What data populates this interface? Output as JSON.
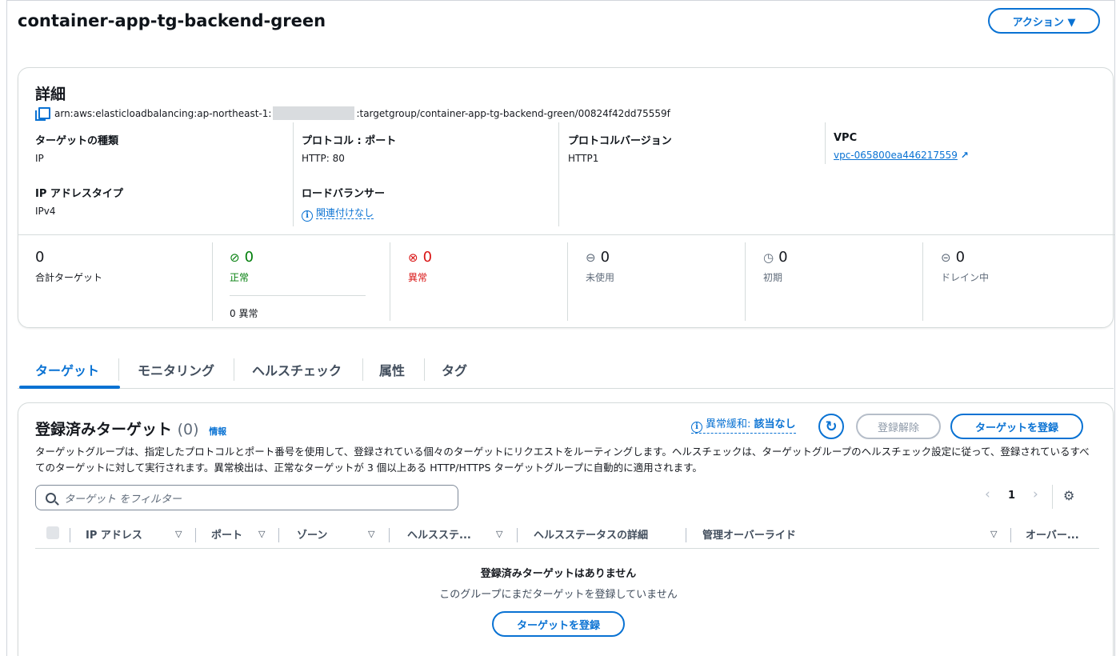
{
  "page": {
    "title": "container-app-tg-backend-green",
    "action_button": "アクション ▼"
  },
  "details": {
    "title": "詳細",
    "arn_prefix": "arn:aws:elasticloadbalancing:ap-northeast-1:",
    "arn_suffix": ":targetgroup/container-app-tg-backend-green/00824f42dd75559f",
    "target_type_label": "ターゲットの種類",
    "target_type_value": "IP",
    "protocol_port_label": "プロトコル : ポート",
    "protocol_port_value": "HTTP: 80",
    "protocol_version_label": "プロトコルバージョン",
    "protocol_version_value": "HTTP1",
    "vpc_label": "VPC",
    "vpc_value": "vpc-065800ea446217559",
    "ip_type_label": "IP アドレスタイプ",
    "ip_type_value": "IPv4",
    "lb_label": "ロードバランサー",
    "lb_value": "関連付けなし"
  },
  "stats": {
    "total_value": "0",
    "total_label": "合計ターゲット",
    "healthy_value": "0",
    "healthy_label": "正常",
    "healthy_anomaly": "0 異常",
    "unhealthy_value": "0",
    "unhealthy_label": "異常",
    "unused_value": "0",
    "unused_label": "未使用",
    "initial_value": "0",
    "initial_label": "初期",
    "draining_value": "0",
    "draining_label": "ドレイン中"
  },
  "tabs": [
    "ターゲット",
    "モニタリング",
    "ヘルスチェック",
    "属性",
    "タグ"
  ],
  "targets": {
    "title": "登録済みターゲット",
    "count": "(0)",
    "info": "情報",
    "anomaly_label": "異常緩和: ",
    "anomaly_value": "該当なし",
    "deregister_button": "登録解除",
    "register_button": "ターゲットを登録",
    "description": "ターゲットグループは、指定したプロトコルとポート番号を使用して、登録されている個々のターゲットにリクエストをルーティングします。ヘルスチェックは、ターゲットグループのヘルスチェック設定に従って、登録されているすべてのターゲットに対して実行されます。異常検出は、正常なターゲットが 3 個以上ある HTTP/HTTPS ターゲットグループに自動的に適用されます。",
    "filter_placeholder": "ターゲット をフィルター",
    "page_number": "1",
    "columns": [
      "IP アドレス",
      "ポート",
      "ゾーン",
      "ヘルスステ...",
      "ヘルスステータスの詳細",
      "管理オーバーライド",
      "オーバー..."
    ],
    "empty_title": "登録済みターゲットはありません",
    "empty_subtitle": "このグループにまだターゲットを登録していません",
    "empty_register_button": "ターゲットを登録"
  }
}
